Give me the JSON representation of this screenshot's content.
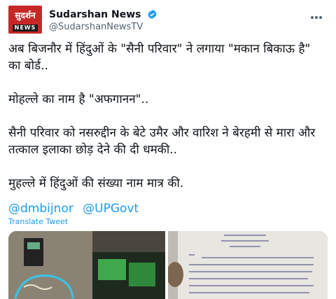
{
  "tweet": {
    "display_name": "Sudarshan News",
    "handle": "@SudarshanNewsTV",
    "avatar": {
      "top_text": "सुदर्शन",
      "bottom_text": "NEWS"
    },
    "paragraphs": [
      "अब बिजनौर में हिंदुओं के \"सैनी परिवार\" ने लगाया \"मकान बिकाऊ है\" का बोर्ड..",
      "मोहल्ले का नाम है \"अफगानन\"..",
      "सैनी परिवार को नसरुद्दीन के बेटे उमैर और वारिश ने बेरहमी से मारा और तत्काल इलाका छोड़ देने की दी धमकी..",
      "मुहल्ले में हिंदुओं की संख्या नाम मात्र की."
    ],
    "mentions": [
      "@dmbijnor",
      "@UPGovt"
    ],
    "translate_label": "Translate Tweet"
  },
  "colors": {
    "link": "#1d9bf0",
    "verified": "#1d9bf0",
    "avatar": "#c62828"
  },
  "icons": {
    "verified": "verified-badge-icon",
    "more": "more-options-icon"
  }
}
